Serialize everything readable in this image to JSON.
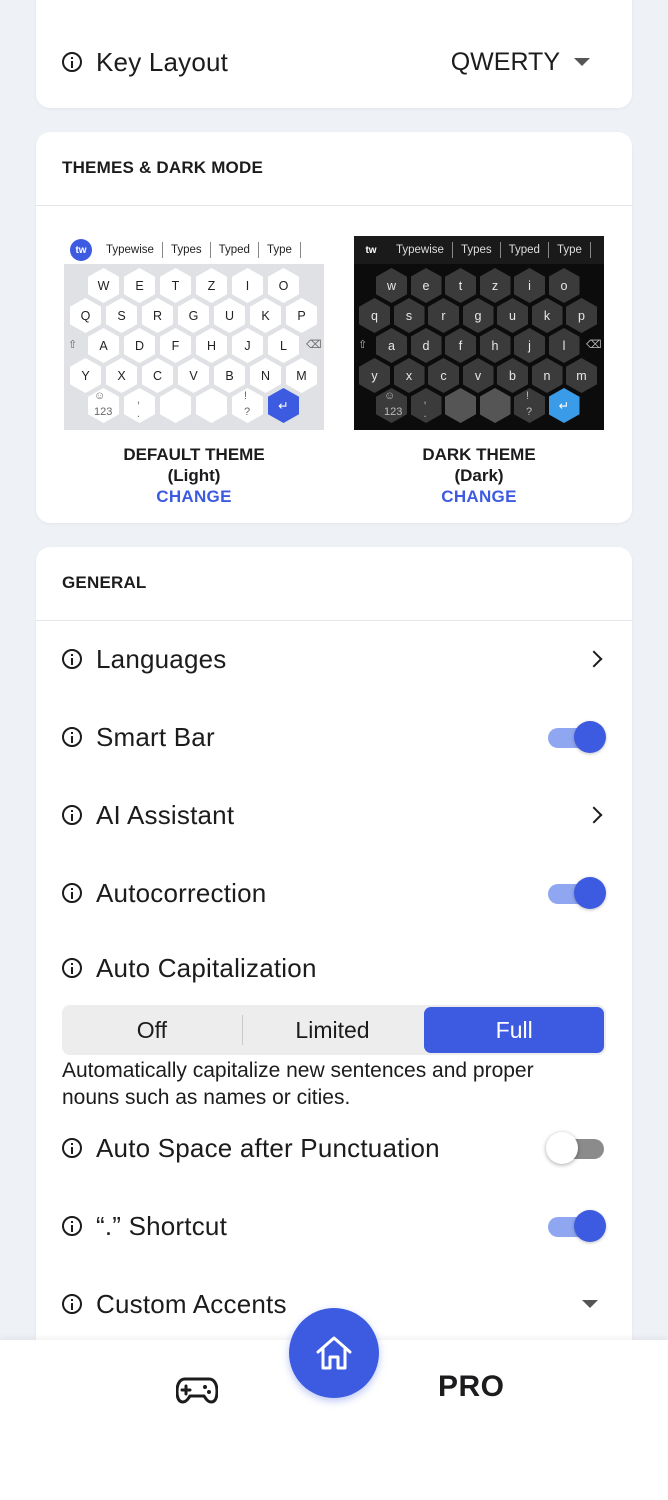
{
  "colors": {
    "accent": "#3d5be0",
    "background": "#eef1f6",
    "card": "#ffffff"
  },
  "key_layout": {
    "label": "Key Layout",
    "value": "QWERTY"
  },
  "themes": {
    "section_title": "THEMES & DARK MODE",
    "light": {
      "name": "DEFAULT THEME",
      "mode": "(Light)",
      "action": "CHANGE"
    },
    "dark": {
      "name": "DARK THEME",
      "mode": "(Dark)",
      "action": "CHANGE"
    },
    "keyboard": {
      "logo": "tw",
      "suggestions": [
        "Typewise",
        "Types",
        "Typed",
        "Type"
      ],
      "rows_light": [
        [
          "W",
          "E",
          "T",
          "Z",
          "I",
          "O"
        ],
        [
          "Q",
          "S",
          "R",
          "G",
          "U",
          "K",
          "P"
        ],
        [
          "A",
          "D",
          "F",
          "H",
          "J",
          "L"
        ],
        [
          "Y",
          "X",
          "C",
          "V",
          "B",
          "N",
          "M"
        ]
      ],
      "rows_dark": [
        [
          "w",
          "e",
          "t",
          "z",
          "i",
          "o"
        ],
        [
          "q",
          "s",
          "r",
          "g",
          "u",
          "k",
          "p"
        ],
        [
          "a",
          "d",
          "f",
          "h",
          "j",
          "l"
        ],
        [
          "y",
          "x",
          "c",
          "v",
          "b",
          "n",
          "m"
        ]
      ],
      "numbers_key": "123",
      "comma": ",",
      "period": ".",
      "exclaim": "!",
      "question": "?"
    }
  },
  "general": {
    "section_title": "GENERAL",
    "languages": "Languages",
    "smart_bar": "Smart Bar",
    "ai_assistant": "AI Assistant",
    "autocorrection": "Autocorrection",
    "auto_capitalization": "Auto Capitalization",
    "capitalization_options": [
      "Off",
      "Limited",
      "Full"
    ],
    "capitalization_selected": "Full",
    "capitalization_description": "Automatically capitalize new sentences and proper nouns such as names or cities.",
    "auto_space": "Auto Space after Punctuation",
    "period_shortcut": "“.” Shortcut",
    "custom_accents": "Custom Accents"
  },
  "toggles": {
    "smart_bar": true,
    "autocorrection": true,
    "auto_space": false,
    "period_shortcut": true
  },
  "nav": {
    "pro_label": "PRO"
  }
}
